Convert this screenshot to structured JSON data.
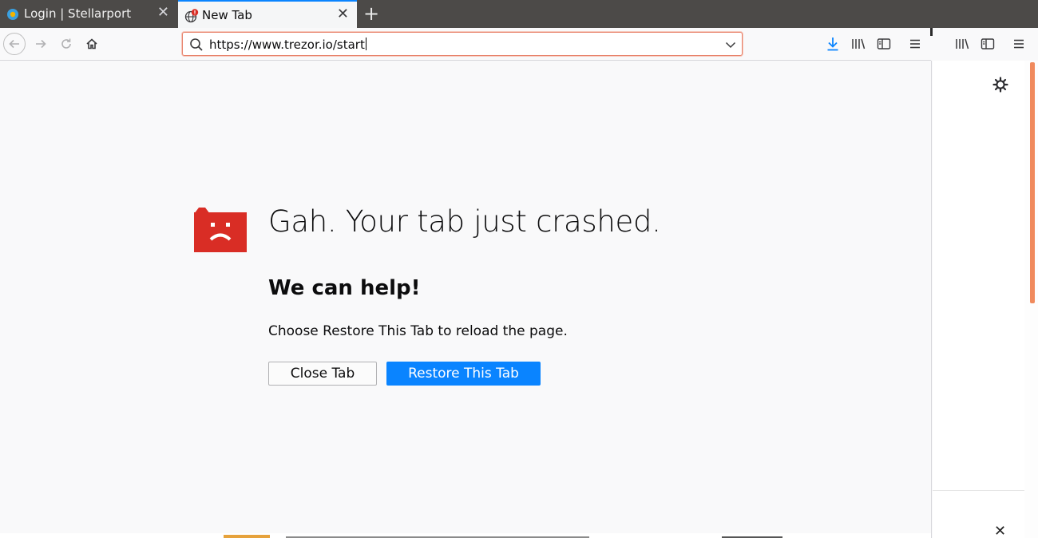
{
  "tabs": [
    {
      "label": "Login | Stellarport",
      "icon": "stellarport-favicon-icon",
      "active": false
    },
    {
      "label": "New Tab",
      "icon": "globe-crashed-icon",
      "active": true
    }
  ],
  "navbar": {
    "url": "https://www.trezor.io/start",
    "icons": [
      "back-arrow-icon",
      "forward-arrow-icon",
      "reload-icon",
      "home-icon",
      "search-icon",
      "chevron-down-icon",
      "download-icon",
      "library-icon",
      "sidebar-icon",
      "menu-icon"
    ]
  },
  "crash_page": {
    "title": "Gah. Your tab just crashed.",
    "help_heading": "We can help!",
    "help_text": "Choose Restore This Tab to reload the page.",
    "close_button": "Close Tab",
    "restore_button": "Restore This Tab"
  },
  "colors": {
    "accent_blue": "#0a84ff",
    "crash_red": "#d92d25",
    "tabbar_bg": "#4c4a48",
    "scroll_thumb": "#f08a5d"
  }
}
